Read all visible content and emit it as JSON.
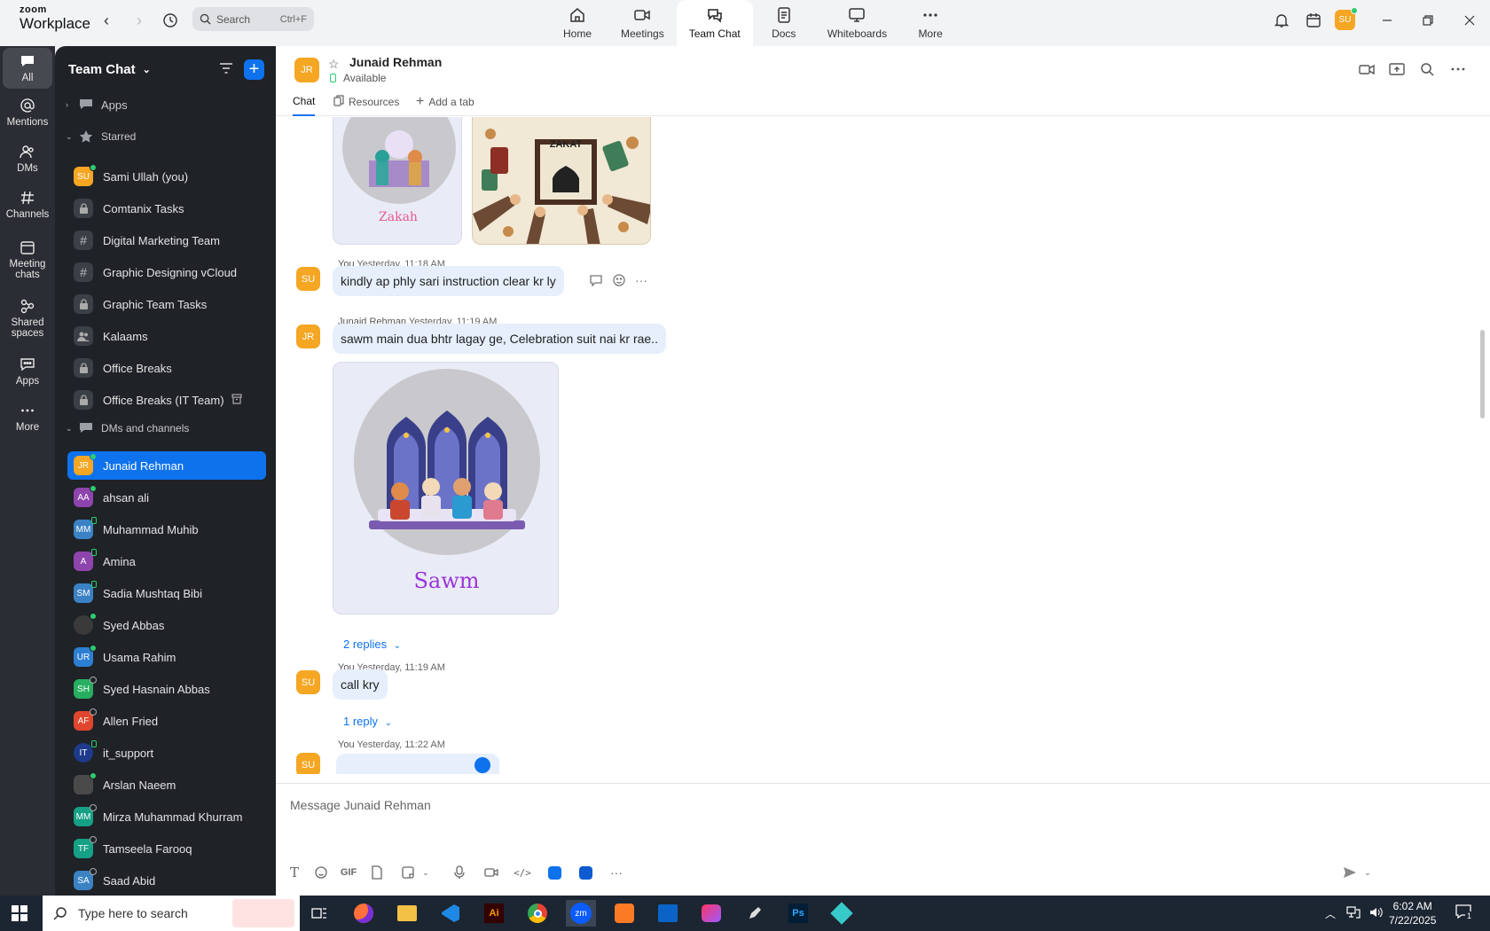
{
  "app": {
    "brand_top": "zoom",
    "brand_bottom": "Workplace"
  },
  "search": {
    "label": "Search",
    "shortcut": "Ctrl+F"
  },
  "top_tabs": [
    {
      "label": "Home",
      "icon": "home-icon"
    },
    {
      "label": "Meetings",
      "icon": "video-icon"
    },
    {
      "label": "Team Chat",
      "icon": "chat-icon",
      "active": true
    },
    {
      "label": "Docs",
      "icon": "doc-icon"
    },
    {
      "label": "Whiteboards",
      "icon": "whiteboard-icon"
    },
    {
      "label": "More",
      "icon": "more-icon"
    }
  ],
  "user": {
    "initials": "SU",
    "status_color": "#2ecc71"
  },
  "rail": [
    {
      "label": "All",
      "active": true
    },
    {
      "label": "Mentions"
    },
    {
      "label": "DMs"
    },
    {
      "label": "Channels"
    },
    {
      "label": "Meeting chats"
    },
    {
      "label": "Shared spaces"
    },
    {
      "label": "Apps"
    },
    {
      "label": "More"
    }
  ],
  "sidebar": {
    "title": "Team Chat",
    "sections": {
      "apps": "Apps",
      "starred": "Starred",
      "dms": "DMs and channels"
    },
    "starred": [
      {
        "name": "Sami Ullah (you)",
        "initials": "SU",
        "color": "#f5a623",
        "kind": "person",
        "status": "online"
      },
      {
        "name": "Comtanix Tasks",
        "kind": "lock"
      },
      {
        "name": "Digital Marketing Team",
        "kind": "hash"
      },
      {
        "name": "Graphic Designing vCloud",
        "kind": "hash"
      },
      {
        "name": "Graphic Team Tasks",
        "kind": "lock"
      },
      {
        "name": "Kalaams",
        "kind": "group"
      },
      {
        "name": "Office Breaks",
        "kind": "lock"
      },
      {
        "name": "Office Breaks (IT Team)",
        "kind": "lock",
        "archived": true
      }
    ],
    "dms": [
      {
        "name": "Junaid Rehman",
        "initials": "JR",
        "color": "#f5a623",
        "status": "online",
        "selected": true
      },
      {
        "name": "ahsan ali",
        "initials": "AA",
        "color": "#8e44ad",
        "status": "online"
      },
      {
        "name": "Muhammad Muhib",
        "initials": "MM",
        "color": "#3b82c4",
        "status": "mobile"
      },
      {
        "name": "Amina",
        "initials": "A",
        "color": "#8e44ad",
        "status": "mobile"
      },
      {
        "name": "Sadia Mushtaq Bibi",
        "initials": "SM",
        "color": "#3b82c4",
        "status": "mobile"
      },
      {
        "name": "Syed Abbas",
        "initials": "",
        "color": "#3a3a3a",
        "status": "online"
      },
      {
        "name": "Usama Rahim",
        "initials": "UR",
        "color": "#2d7fd3",
        "status": "online"
      },
      {
        "name": "Syed Hasnain Abbas",
        "initials": "SH",
        "color": "#27ae60",
        "status": "away"
      },
      {
        "name": "Allen Fried",
        "initials": "AF",
        "color": "#e0452d",
        "status": "away"
      },
      {
        "name": "it_support",
        "initials": "IT",
        "color": "#1e3a8a",
        "status": "mobile"
      },
      {
        "name": "Arslan Naeem",
        "initials": "",
        "color": "#4a4a4a",
        "status": "online"
      },
      {
        "name": "Mirza Muhammad Khurram",
        "initials": "MM",
        "color": "#16a085",
        "status": "away"
      },
      {
        "name": "Tamseela Farooq",
        "initials": "TF",
        "color": "#16a085",
        "status": "away"
      },
      {
        "name": "Saad Abid",
        "initials": "SA",
        "color": "#3b82c4",
        "status": "away"
      }
    ]
  },
  "chat_header": {
    "initials": "JR",
    "name": "Junaid Rehman",
    "status": "Available",
    "tabs": [
      "Chat",
      "Resources",
      "Add a tab"
    ]
  },
  "messages": {
    "img1_caption": "Zakah",
    "img2_title": "ZAKAT",
    "m1": {
      "sender": "You",
      "time": "Yesterday, 11:18 AM",
      "initials": "SU",
      "text": "kindly ap phly sari instruction clear kr ly"
    },
    "m2": {
      "sender": "Junaid Rehman",
      "time": "Yesterday, 11:19 AM",
      "initials": "JR",
      "text": "sawm main dua bhtr lagay ge, Celebration suit nai kr rae..",
      "image_caption": "Sawm",
      "replies": "2 replies"
    },
    "m3": {
      "sender": "You",
      "time": "Yesterday, 11:19 AM",
      "initials": "SU",
      "text": "call kry",
      "replies": "1 reply"
    },
    "m4": {
      "sender": "You",
      "time": "Yesterday, 11:22 AM",
      "initials": "SU"
    }
  },
  "composer": {
    "placeholder": "Message Junaid Rehman",
    "gif": "GIF"
  },
  "taskbar": {
    "search_placeholder": "Type here to search",
    "time": "6:02 AM",
    "date": "7/22/2025",
    "notifications": "1",
    "apps": [
      "task-view",
      "firefox",
      "file-explorer",
      "vscode",
      "illustrator",
      "chrome",
      "zoom",
      "xampp",
      "outlook",
      "creative-cloud",
      "pen-tool",
      "photoshop",
      "app"
    ]
  }
}
